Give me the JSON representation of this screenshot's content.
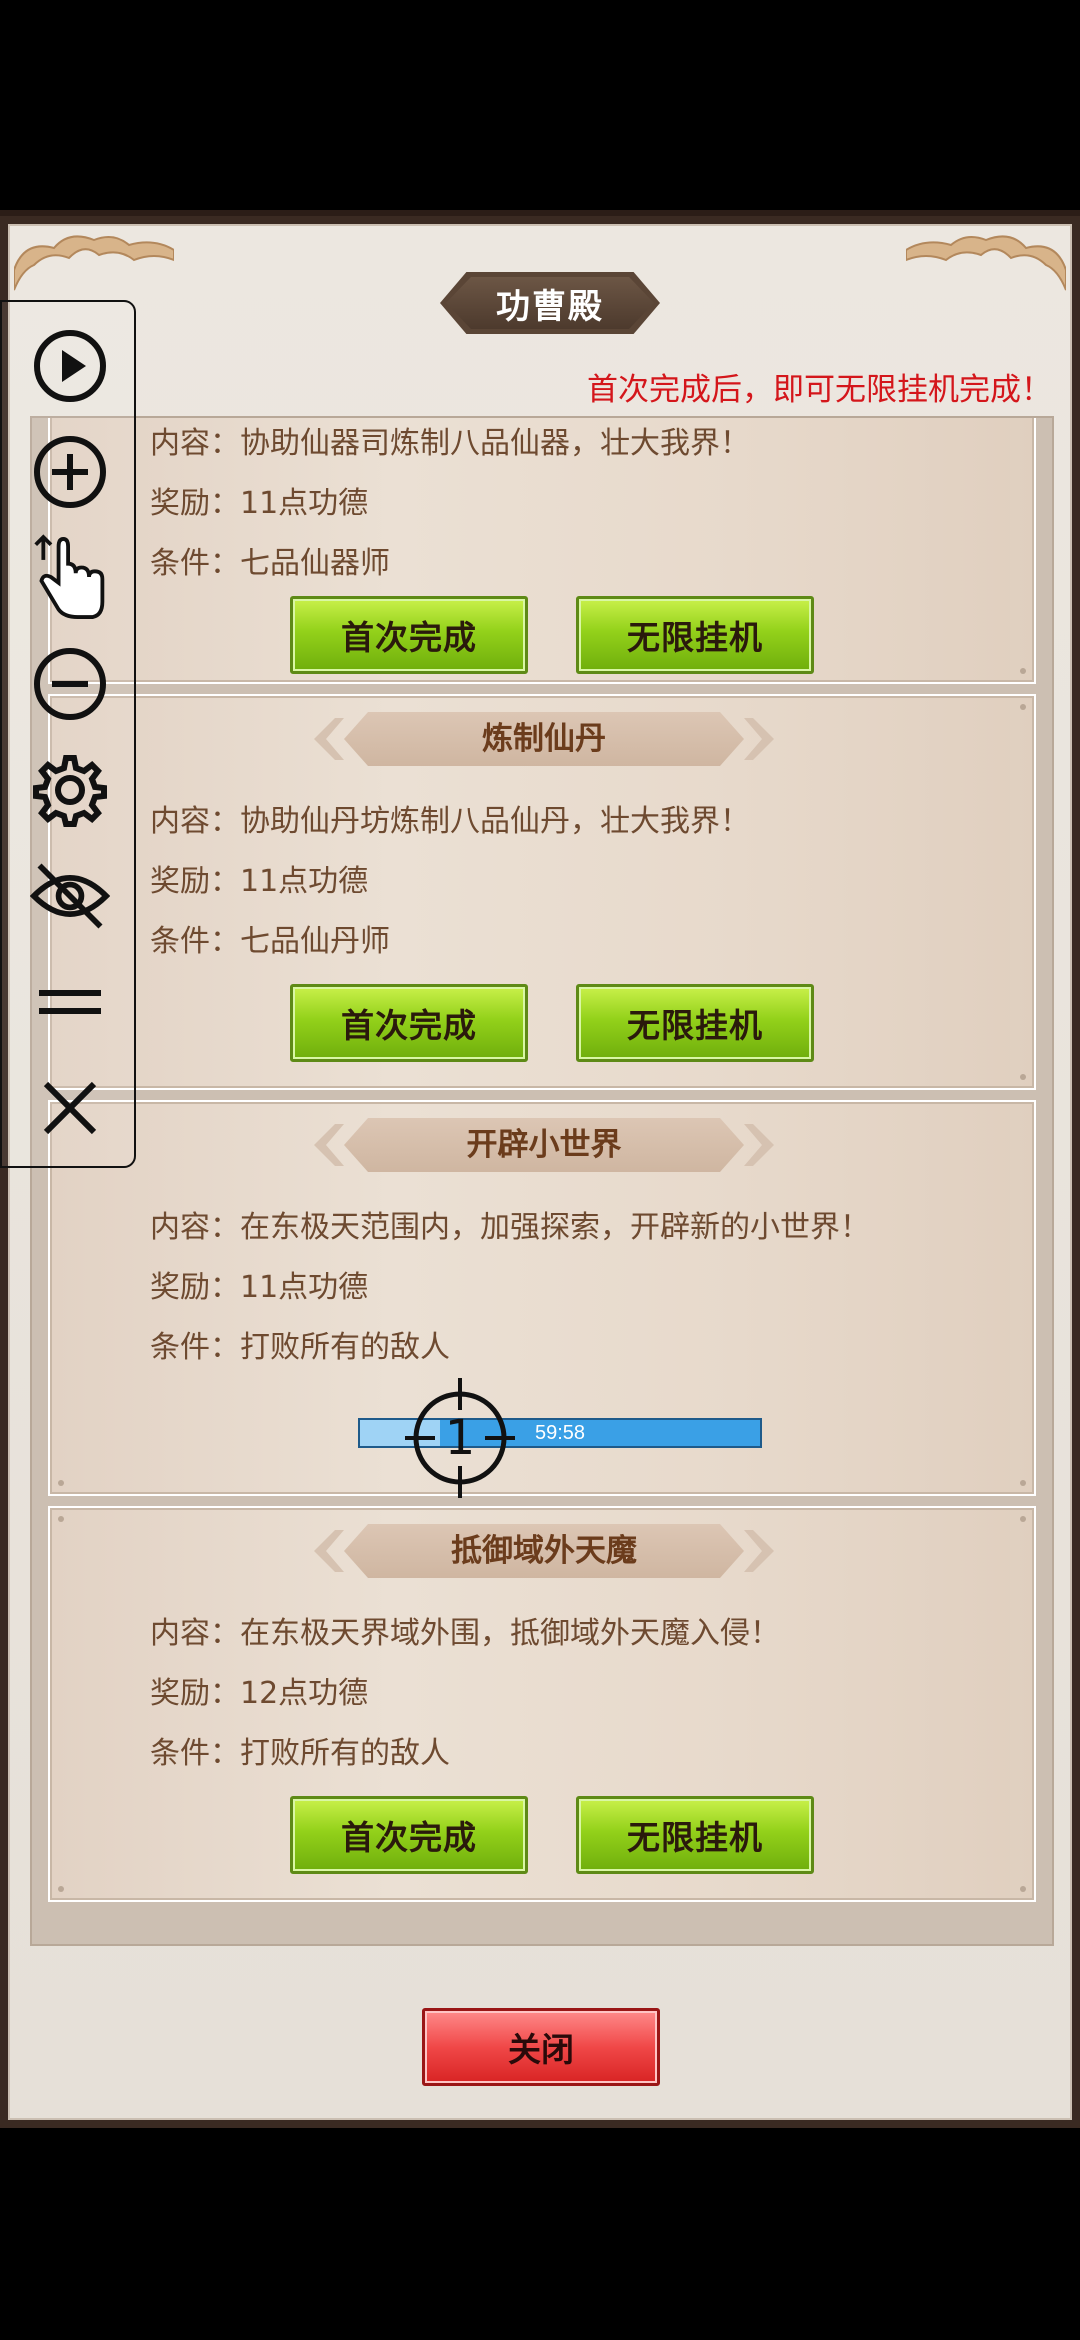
{
  "title": "功曹殿",
  "notice": "首次完成后，即可无限挂机完成！",
  "labels": {
    "content": "内容：",
    "reward": "奖励：",
    "condition": "条件："
  },
  "cards": [
    {
      "name": "",
      "content": "协助仙器司炼制八品仙器，壮大我界！",
      "reward": "11点功德",
      "condition": "七品仙器师",
      "buttons": [
        "首次完成",
        "无限挂机"
      ]
    },
    {
      "name": "炼制仙丹",
      "content": "协助仙丹坊炼制八品仙丹，壮大我界！",
      "reward": "11点功德",
      "condition": "七品仙丹师",
      "buttons": [
        "首次完成",
        "无限挂机"
      ]
    },
    {
      "name": "开辟小世界",
      "content": "在东极天范围内，加强探索，开辟新的小世界！",
      "reward": "11点功德",
      "condition": "打败所有的敌人",
      "progress": {
        "time": "59:58",
        "fraction": 0.2,
        "marker": "1"
      }
    },
    {
      "name": "抵御域外天魔",
      "content": "在东极天界域外围，抵御域外天魔入侵！",
      "reward": "12点功德",
      "condition": "打败所有的敌人",
      "buttons": [
        "首次完成",
        "无限挂机"
      ]
    }
  ],
  "close_label": "关闭",
  "toolbar": [
    "play-icon",
    "zoom-in-icon",
    "tap-hand-icon",
    "zoom-out-icon",
    "gear-icon",
    "eye-off-icon",
    "equals-icon",
    "close-icon"
  ],
  "colors": {
    "notice": "#d4161b",
    "button_green": "#93d11a",
    "button_red": "#f04848",
    "progress": "#3aa0e6"
  }
}
